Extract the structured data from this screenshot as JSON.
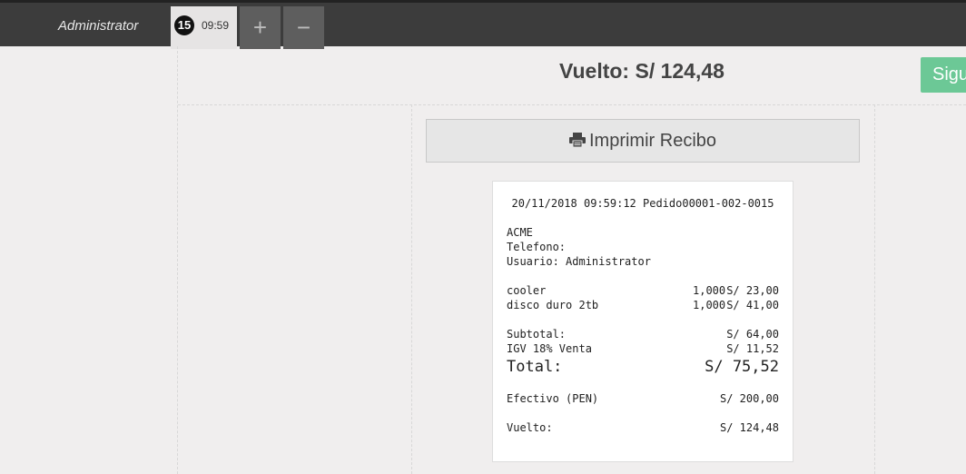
{
  "header": {
    "user": "Administrator",
    "order_tab": {
      "number": "15",
      "time": "09:59"
    },
    "add_label": "+",
    "remove_label": "−"
  },
  "summary": {
    "change_title": "Vuelto: S/ 124,48",
    "next_label": "Sigu"
  },
  "print": {
    "label": "Imprimir Recibo",
    "icon": "printer-icon"
  },
  "receipt": {
    "header_line": "20/11/2018 09:59:12 Pedido00001-002-0015",
    "company": "ACME",
    "phone": "Telefono:",
    "user": "Usuario: Administrator",
    "items": [
      {
        "name": "cooler",
        "qty": "1,000",
        "price": "S/ 23,00"
      },
      {
        "name": "disco duro 2tb",
        "qty": "1,000",
        "price": "S/ 41,00"
      }
    ],
    "subtotal_label": "Subtotal:",
    "subtotal_value": "S/ 64,00",
    "tax_label": "IGV 18% Venta",
    "tax_value": "S/ 11,52",
    "total_label": "Total:",
    "total_value": "S/ 75,52",
    "payment_label": "Efectivo (PEN)",
    "payment_value": "S/ 200,00",
    "change_label": "Vuelto:",
    "change_value": "S/ 124,48"
  }
}
